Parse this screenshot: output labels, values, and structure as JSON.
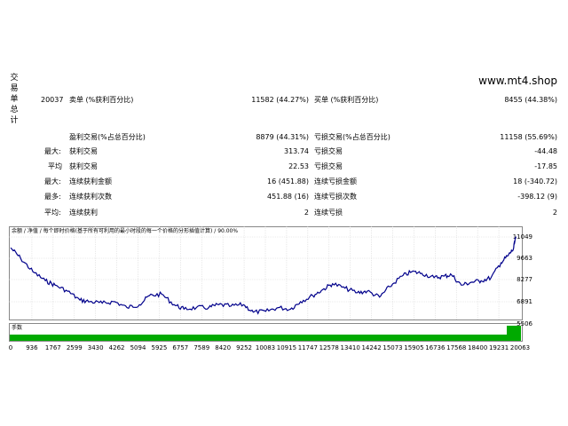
{
  "side_label": [
    "交",
    "易",
    "单",
    "总",
    "计"
  ],
  "watermark": "www.mt4.shop",
  "stats": {
    "total_trades": "20037",
    "short_label": "卖单 (%获利百分比)",
    "short_value": "11582 (44.27%)",
    "long_label": "买单 (%获利百分比)",
    "long_value": "8455 (44.38%)",
    "profit_trades_label": "盈利交易(%占总百分比)",
    "profit_trades_value": "8879 (44.31%)",
    "loss_trades_label": "亏损交易(%占总百分比)",
    "loss_trades_value": "11158 (55.69%)",
    "largest_label": "最大:",
    "largest_profit_label": "获利交易",
    "largest_profit_value": "313.74",
    "largest_loss_label": "亏损交易",
    "largest_loss_value": "-44.48",
    "average_label": "平均",
    "average_profit_label": "获利交易",
    "average_profit_value": "22.53",
    "average_loss_label": "亏损交易",
    "average_loss_value": "-17.85",
    "max_label": "最大:",
    "max_consec_wins_label": "连续获利金额",
    "max_consec_wins_value": "16 (451.88)",
    "max_consec_losses_label": "连续亏损金额",
    "max_consec_losses_value": "18 (-340.72)",
    "maximal_label": "最多:",
    "maximal_consec_profit_label": "连续获利次数",
    "maximal_consec_profit_value": "451.88 (16)",
    "maximal_consec_loss_label": "连续亏损次数",
    "maximal_consec_loss_value": "-398.12 (9)",
    "avg_consec_label": "平均:",
    "avg_consec_wins_label": "连续获利",
    "avg_consec_wins_value": "2",
    "avg_consec_losses_label": "连续亏损",
    "avg_consec_losses_value": "2"
  },
  "chart_data": {
    "type": "line",
    "legend_text": "余额 / 净值 / 每个即时价格(基于所有可利用的最小时段的每一个价格的分形插值计算) / 90.00%",
    "y_ticks": [
      "11049",
      "9663",
      "8277",
      "6891",
      "5506"
    ],
    "x_ticks": [
      "0",
      "936",
      "1767",
      "2599",
      "3430",
      "4262",
      "5094",
      "5925",
      "6757",
      "7589",
      "8420",
      "9252",
      "10083",
      "10915",
      "11747",
      "12578",
      "13410",
      "14242",
      "15073",
      "15905",
      "16736",
      "17568",
      "18400",
      "19231",
      "20063"
    ],
    "volume_label": "手数",
    "x_range": [
      0,
      20500
    ],
    "y_range": [
      5506,
      11500
    ],
    "series": [
      {
        "color": "#00008b",
        "x": [
          0,
          400,
          900,
          1400,
          1800,
          2300,
          2800,
          3200,
          3700,
          4200,
          4700,
          5200,
          5600,
          6100,
          6600,
          7000,
          7500,
          8000,
          8400,
          8900,
          9400,
          9800,
          10300,
          10800,
          11300,
          11700,
          12200,
          12600,
          13000,
          13500,
          14000,
          14400,
          14900,
          15300,
          15800,
          16200,
          16600,
          17100,
          17500,
          17800,
          18200,
          18600,
          19000,
          19400,
          19800,
          20100,
          20300,
          20400
        ],
        "y": [
          10300,
          9600,
          8700,
          8100,
          7800,
          7400,
          6800,
          6700,
          6600,
          6700,
          6300,
          6500,
          7100,
          7200,
          6500,
          6200,
          6300,
          6300,
          6500,
          6400,
          6500,
          6000,
          6050,
          6300,
          6200,
          6700,
          7100,
          7500,
          7900,
          7600,
          7300,
          7400,
          7000,
          7700,
          8400,
          8700,
          8600,
          8300,
          8400,
          8500,
          7800,
          8000,
          8100,
          8300,
          9300,
          9800,
          10200,
          11050
        ]
      }
    ]
  },
  "colors": {
    "line": "#00008b",
    "volume": "#00aa00",
    "grid": "#d8d8d8"
  }
}
